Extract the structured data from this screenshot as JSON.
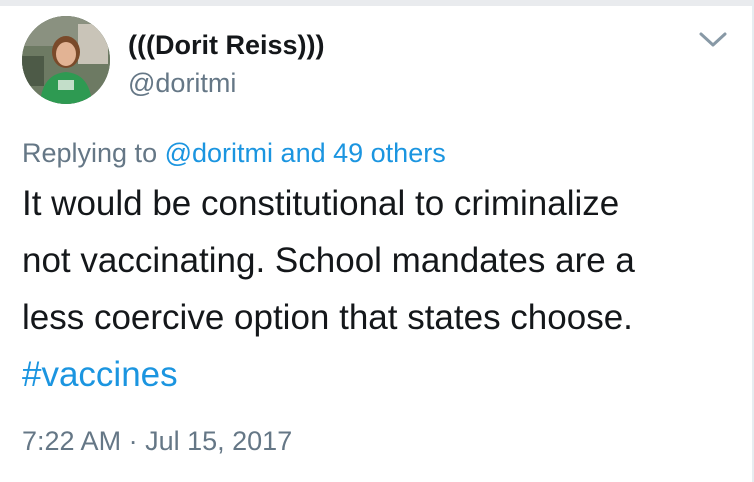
{
  "tweet": {
    "display_name": "(((Dorit Reiss)))",
    "handle": "@doritmi",
    "replying_prefix": "Replying to",
    "replying_user": "@doritmi",
    "replying_and": "and",
    "replying_others": "49 others",
    "text_lines": [
      "It would be constitutional to criminalize",
      "not vaccinating. School mandates are a",
      "less coercive option that states choose."
    ],
    "hashtag": "#vaccines",
    "time": "7:22 AM",
    "separator": "·",
    "date": "Jul 15, 2017"
  },
  "icons": {
    "menu": "chevron-down-icon"
  },
  "colors": {
    "link": "#1b95e0",
    "secondary_text": "#657786",
    "primary_text": "#14171a"
  }
}
